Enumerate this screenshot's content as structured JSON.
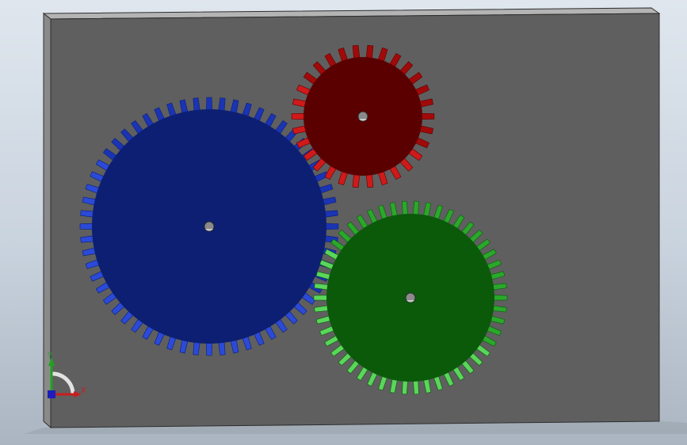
{
  "viewport": {
    "background_top": "#dfe6ee",
    "background_bottom": "#aab5c1"
  },
  "plate": {
    "face_color": "#5f5f5f",
    "edge_color": "#8a8a8a",
    "top_edge_color": "#b4b4b4",
    "outline_color": "#2e2e2e"
  },
  "gears": [
    {
      "id": "blue",
      "name": "blue-gear",
      "teeth": 60,
      "color_body": "#0c1f72",
      "color_tooth": "#1a34b4",
      "color_tooth_edge": "#2b4ad8",
      "hub_icon": "hole"
    },
    {
      "id": "red",
      "name": "red-gear",
      "teeth": 30,
      "color_body": "#5a0000",
      "color_tooth": "#a10a0a",
      "color_tooth_edge": "#d01a1a",
      "hub_icon": "hole"
    },
    {
      "id": "green",
      "name": "green-gear",
      "teeth": 50,
      "color_body": "#0a5a0a",
      "color_tooth": "#2aa82a",
      "color_tooth_edge": "#5ad65a",
      "hub_icon": "hole"
    }
  ],
  "triad": {
    "y_label": "Y",
    "x_label": "X",
    "y_color": "#1fa31f",
    "x_color": "#c81e1e",
    "z_color": "#1d1dbb"
  }
}
